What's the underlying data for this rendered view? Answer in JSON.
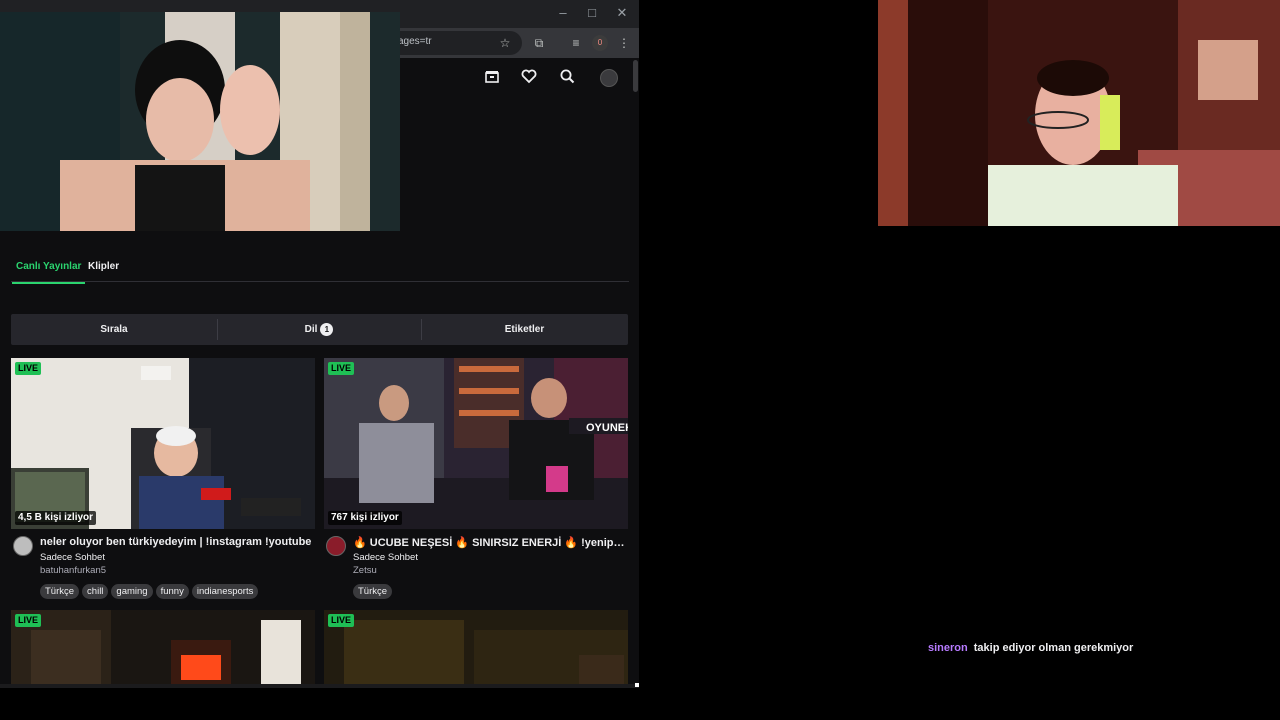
{
  "browser": {
    "address_fragment": "ages=tr",
    "extension_badge": "0",
    "window_controls": [
      "–",
      "□",
      "✕"
    ],
    "toolbar_icons": [
      "star-icon",
      "extension-icon",
      "playlist-icon",
      "kebab-menu-icon"
    ]
  },
  "twitch_header": {
    "icons": [
      "prime-loot-icon",
      "following-heart-icon",
      "search-icon",
      "user-avatar"
    ]
  },
  "tabs": [
    {
      "label": "Canlı Yayınlar",
      "active": true
    },
    {
      "label": "Klipler",
      "active": false
    }
  ],
  "filters": {
    "sort_label": "Sırala",
    "language_label": "Dil",
    "language_count": "1",
    "tags_label": "Etiketler"
  },
  "streams": [
    {
      "live": "LIVE",
      "viewers": "4,5 B kişi izliyor",
      "title": "neler oluyor ben türkiyedeyim | !instagram !youtube",
      "category": "Sadece Sohbet",
      "channel": "batuhanfurkan5",
      "tags": [
        "Türkçe",
        "chill",
        "gaming",
        "funny",
        "indianesports"
      ]
    },
    {
      "live": "LIVE",
      "viewers": "767 kişi izliyor",
      "title": "🔥 UCUBE NEŞESİ 🔥 SINIRSIZ ENERJİ 🔥 !yenipvpt...",
      "category": "Sadece Sohbet",
      "channel": "Zetsu",
      "tags": [
        "Türkçe"
      ]
    },
    {
      "live": "LIVE"
    },
    {
      "live": "LIVE"
    }
  ],
  "chat": {
    "username": "sineron",
    "message": "takip ediyor olman gerekmiyor"
  },
  "colors": {
    "accent_green": "#2bd46f",
    "live_green": "#1fbf55",
    "chat_username": "#b77bff",
    "page_bg": "#0e0e10"
  }
}
